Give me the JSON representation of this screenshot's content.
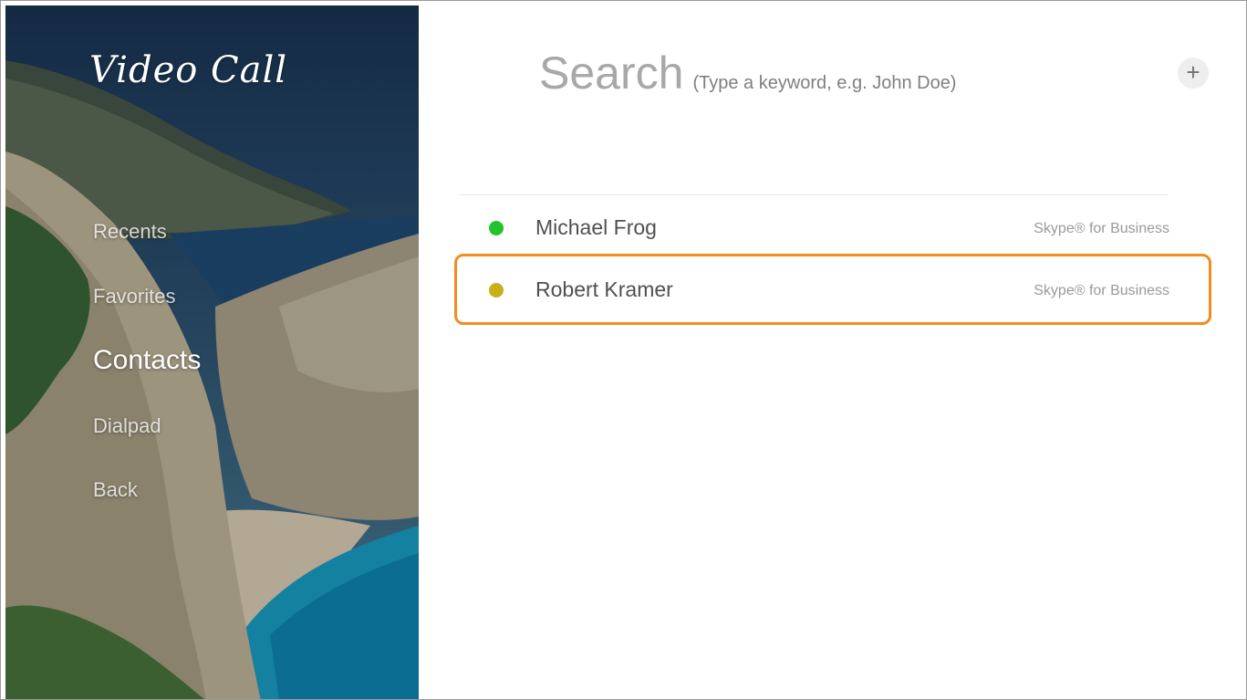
{
  "app": {
    "title": "Video Call"
  },
  "nav": {
    "items": [
      {
        "label": "Recents",
        "active": false
      },
      {
        "label": "Favorites",
        "active": false
      },
      {
        "label": "Contacts",
        "active": true
      },
      {
        "label": "Dialpad",
        "active": false
      },
      {
        "label": "Back",
        "active": false
      }
    ]
  },
  "search": {
    "title": "Search",
    "hint": "(Type a keyword, e.g. John Doe)"
  },
  "add_button": {
    "label": "+",
    "icon": "plus-icon"
  },
  "contacts": [
    {
      "name": "Michael Frog",
      "service": "Skype® for Business",
      "status": "online",
      "status_color": "#22c42c",
      "selected": false
    },
    {
      "name": "Robert Kramer",
      "service": "Skype® for Business",
      "status": "away",
      "status_color": "#c9b01a",
      "selected": true
    }
  ],
  "colors": {
    "selection_outline": "#f58b1f",
    "search_text": "#a8a8a8"
  }
}
